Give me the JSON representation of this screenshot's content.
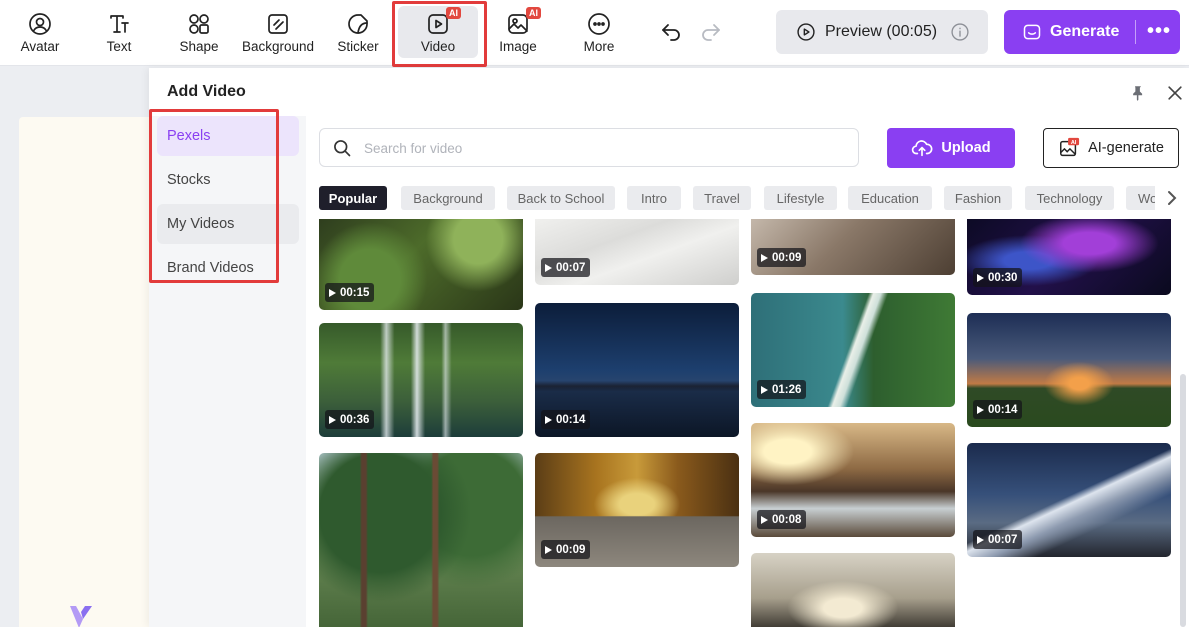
{
  "toolbar": {
    "tools": [
      {
        "label": "Avatar",
        "icon": "avatar-icon"
      },
      {
        "label": "Text",
        "icon": "text-icon"
      },
      {
        "label": "Shape",
        "icon": "shape-icon"
      },
      {
        "label": "Background",
        "icon": "background-icon"
      },
      {
        "label": "Sticker",
        "icon": "sticker-icon"
      },
      {
        "label": "Video",
        "icon": "video-icon",
        "badge": "AI",
        "active": true
      },
      {
        "label": "Image",
        "icon": "image-icon",
        "badge": "AI"
      },
      {
        "label": "More",
        "icon": "more-icon"
      }
    ],
    "preview_label": "Preview (00:05)",
    "generate_label": "Generate"
  },
  "panel": {
    "title": "Add Video",
    "sidebar": [
      "Pexels",
      "Stocks",
      "My Videos",
      "Brand Videos"
    ],
    "selected_source": "Pexels",
    "search_placeholder": "Search for video",
    "upload_label": "Upload",
    "ai_generate_label": "AI-generate",
    "ai_badge": "AI",
    "categories": [
      "Popular",
      "Background",
      "Back to School",
      "Intro",
      "Travel",
      "Lifestyle",
      "Education",
      "Fashion",
      "Technology",
      "Wo"
    ],
    "selected_category": "Popular",
    "videos": [
      {
        "duration": "00:15",
        "scene": "green-foliage"
      },
      {
        "duration": "00:36",
        "scene": "waterfall"
      },
      {
        "duration": "",
        "scene": "pine-trees"
      },
      {
        "duration": "00:07",
        "scene": "white-fabric"
      },
      {
        "duration": "00:14",
        "scene": "mountain-lake-night"
      },
      {
        "duration": "00:09",
        "scene": "autumn-road"
      },
      {
        "duration": "00:09",
        "scene": "blurred-brown"
      },
      {
        "duration": "01:26",
        "scene": "aerial-coast"
      },
      {
        "duration": "00:08",
        "scene": "sunset-waves"
      },
      {
        "duration": "",
        "scene": "grass-sunset"
      },
      {
        "duration": "00:30",
        "scene": "purple-particles"
      },
      {
        "duration": "00:14",
        "scene": "field-sunset"
      },
      {
        "duration": "00:07",
        "scene": "starry-mountain"
      }
    ]
  },
  "colors": {
    "accent": "#8a3ff2",
    "highlight_box": "#e23b3b",
    "ai_badge": "#e2483f"
  }
}
